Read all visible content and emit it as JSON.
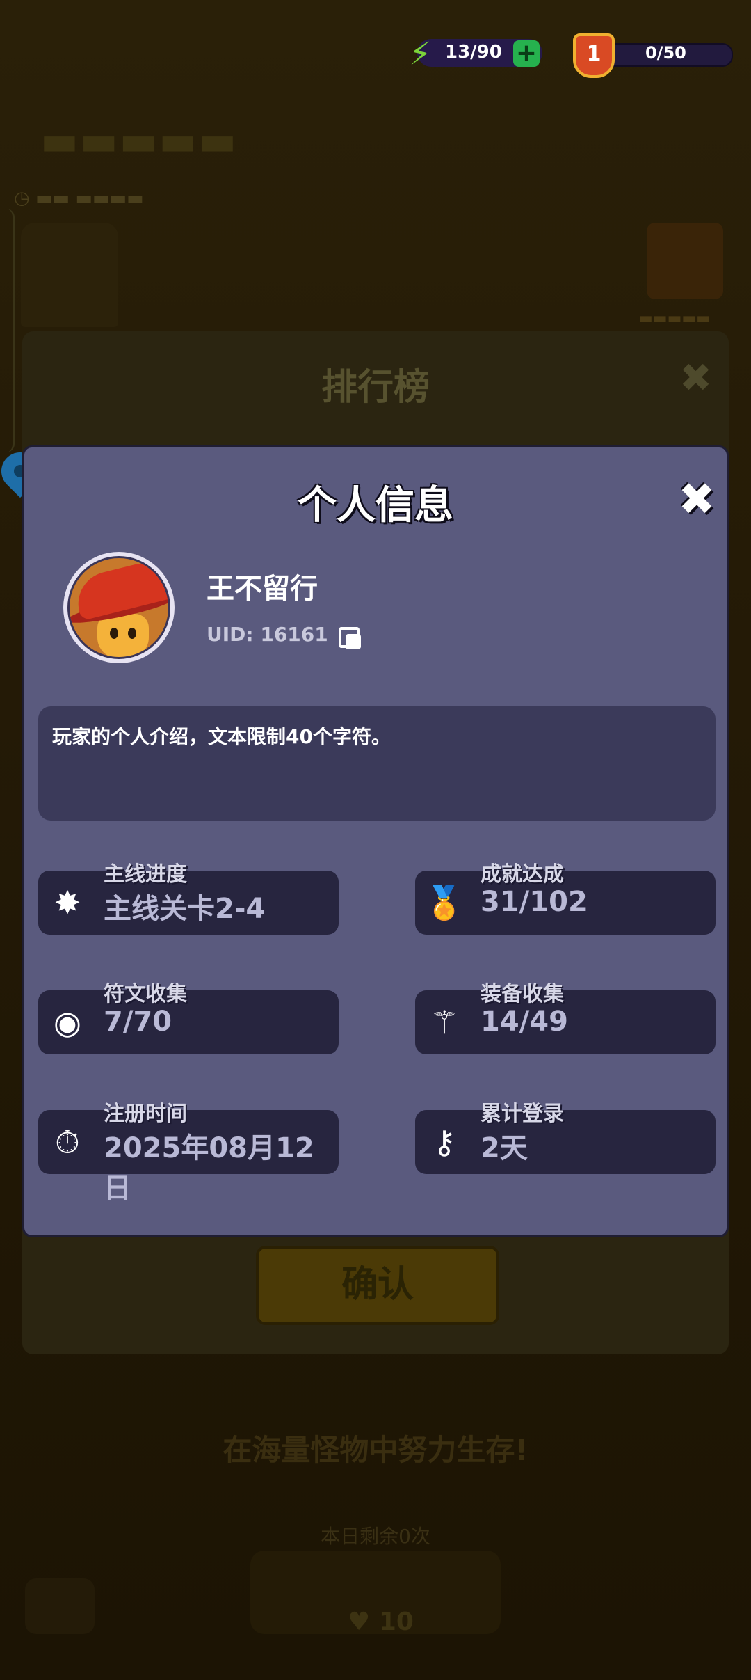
{
  "top_bar": {
    "energy": "13/90",
    "energy_plus": "+",
    "level_badge": "1",
    "progress": "0/50"
  },
  "leaderboard": {
    "title": "排行榜",
    "close": "✖",
    "confirm_label": "确认"
  },
  "profile": {
    "title": "个人信息",
    "close": "✖",
    "player_name": "王不留行",
    "uid": "UID: 16161",
    "intro": "玩家的个人介绍，文本限制40个字符。",
    "stats": [
      {
        "label": "主线进度",
        "value": "主线关卡2-4",
        "icon": "starburst-icon"
      },
      {
        "label": "成就达成",
        "value": "31/102",
        "icon": "medal-icon"
      },
      {
        "label": "符文收集",
        "value": "7/70",
        "icon": "rune-stone-icon"
      },
      {
        "label": "装备收集",
        "value": "14/49",
        "icon": "staff-icon"
      },
      {
        "label": "注册时间",
        "value": "2025年08月12日",
        "icon": "stopwatch-icon"
      },
      {
        "label": "累计登录",
        "value": "2天",
        "icon": "key-icon"
      }
    ]
  },
  "background": {
    "slogan": "在海量怪物中努力生存!",
    "remaining": "本日剩余0次",
    "cost": "10"
  }
}
